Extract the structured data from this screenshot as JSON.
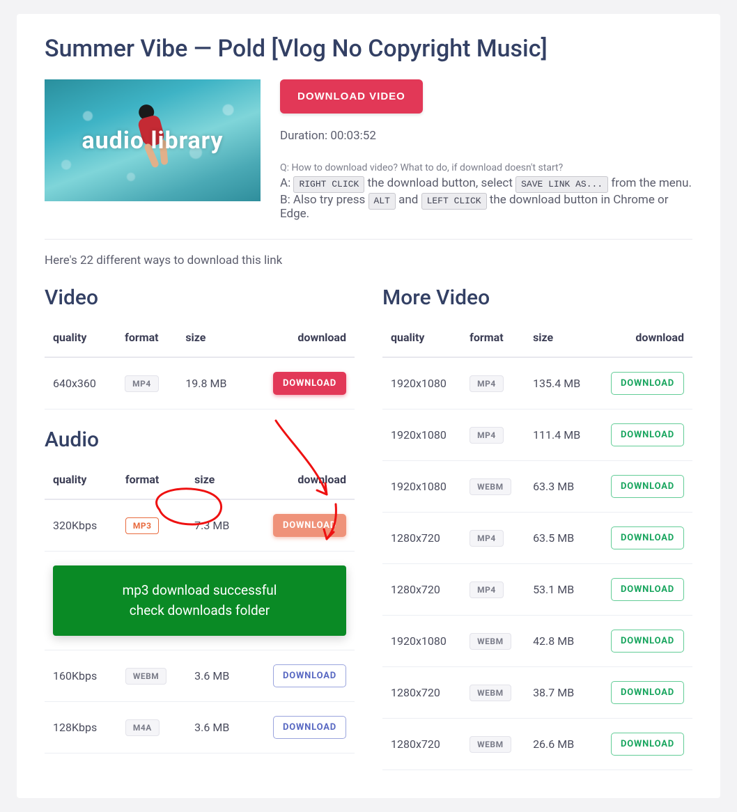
{
  "title": "Summer Vibe — Pold [Vlog No Copyright Music]",
  "thumb_text": "audio library",
  "download_video_btn": "DOWNLOAD VIDEO",
  "duration_label": "Duration: 00:03:52",
  "faq": {
    "q": "Q: How to download video? What to do, if download doesn't start?",
    "a_prefix": "A: ",
    "a_kbd1": "RIGHT CLICK",
    "a_mid": " the download button, select ",
    "a_kbd2": "SAVE LINK AS...",
    "a_suffix": " from the menu.",
    "b_prefix": "B: Also try press ",
    "b_kbd1": "ALT",
    "b_mid": " and ",
    "b_kbd2": "LEFT CLICK",
    "b_suffix": " the download button in Chrome or Edge."
  },
  "lead": "Here's 22 different ways to download this link",
  "headers": {
    "quality": "quality",
    "format": "format",
    "size": "size",
    "download": "download"
  },
  "download_label": "DOWNLOAD",
  "sections": {
    "video": "Video",
    "audio": "Audio",
    "more": "More Video"
  },
  "video_rows": [
    {
      "quality": "640x360",
      "format": "MP4",
      "size": "19.8 MB",
      "style": "red"
    }
  ],
  "audio_rows": [
    {
      "quality": "320Kbps",
      "format": "MP3",
      "size": "7.3 MB",
      "style": "peach",
      "fmt_class": "mp3"
    },
    {
      "quality": "160Kbps",
      "format": "WEBM",
      "size": "3.6 MB",
      "style": "blue"
    },
    {
      "quality": "128Kbps",
      "format": "M4A",
      "size": "3.6 MB",
      "style": "blue"
    }
  ],
  "success_line1": "mp3 download successful",
  "success_line2": "check downloads folder",
  "more_rows": [
    {
      "quality": "1920x1080",
      "format": "MP4",
      "size": "135.4 MB",
      "style": "green"
    },
    {
      "quality": "1920x1080",
      "format": "MP4",
      "size": "111.4 MB",
      "style": "green"
    },
    {
      "quality": "1920x1080",
      "format": "WEBM",
      "size": "63.3 MB",
      "style": "green"
    },
    {
      "quality": "1280x720",
      "format": "MP4",
      "size": "63.5 MB",
      "style": "green"
    },
    {
      "quality": "1280x720",
      "format": "MP4",
      "size": "53.1 MB",
      "style": "green"
    },
    {
      "quality": "1920x1080",
      "format": "WEBM",
      "size": "42.8 MB",
      "style": "green"
    },
    {
      "quality": "1280x720",
      "format": "WEBM",
      "size": "38.7 MB",
      "style": "green"
    },
    {
      "quality": "1280x720",
      "format": "WEBM",
      "size": "26.6 MB",
      "style": "green"
    }
  ]
}
